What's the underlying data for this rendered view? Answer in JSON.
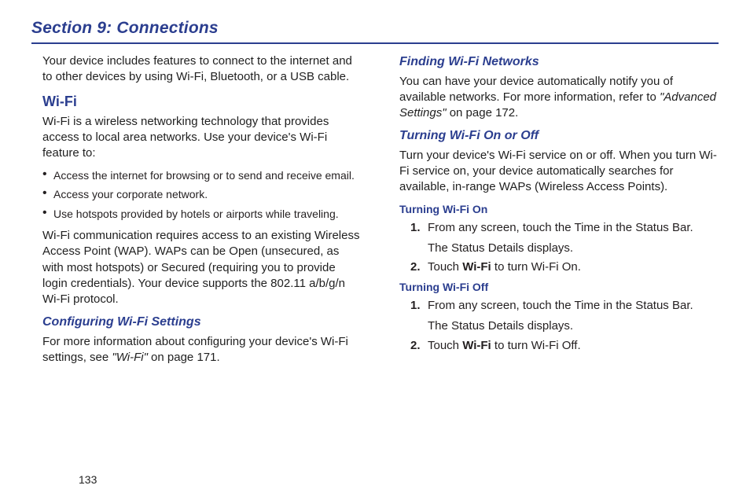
{
  "section": {
    "title": "Section 9: Connections"
  },
  "left": {
    "intro": "Your device includes features to connect to the internet and to other devices by using Wi-Fi, Bluetooth, or a USB cable.",
    "wifi_h2": "Wi-Fi",
    "wifi_intro": "Wi-Fi is a wireless networking technology that provides access to local area networks. Use your device's Wi-Fi feature to:",
    "bullets": [
      "Access the internet for browsing or to send and receive email.",
      "Access your corporate network.",
      "Use hotspots provided by hotels or airports while traveling."
    ],
    "wifi_wap": "Wi-Fi communication requires access to an existing Wireless Access Point (WAP). WAPs can be Open (unsecured, as with most hotspots) or Secured (requiring you to provide login credentials). Your device supports the 802.11 a/b/g/n Wi-Fi protocol.",
    "conf_h3": "Configuring Wi-Fi Settings",
    "conf_text_pre": "For more information about configuring your device's Wi-Fi settings, see ",
    "conf_ref": "\"Wi-Fi\"",
    "conf_text_post": " on page 171."
  },
  "right": {
    "find_h3": "Finding Wi-Fi Networks",
    "find_text_pre": "You can have your device automatically notify you of available networks. For more information, refer to ",
    "find_ref": "\"Advanced Settings\"",
    "find_text_post": "  on page 172.",
    "turn_h3": "Turning Wi-Fi On or Off",
    "turn_text": "Turn your device's Wi-Fi service on or off. When you turn Wi-Fi service on, your device automatically searches for available, in-range WAPs (Wireless Access Points).",
    "on_h4": "Turning Wi-Fi On",
    "on_steps": [
      {
        "num": "1.",
        "main": "From any screen, touch the Time in the Status Bar.",
        "sub": "The Status Details displays."
      },
      {
        "num": "2.",
        "main_pre": "Touch ",
        "main_bold": "Wi-Fi",
        "main_post": " to turn Wi-Fi On."
      }
    ],
    "off_h4": "Turning Wi-Fi Off",
    "off_steps": [
      {
        "num": "1.",
        "main": "From any screen, touch the Time in the Status Bar.",
        "sub": "The Status Details displays."
      },
      {
        "num": "2.",
        "main_pre": "Touch ",
        "main_bold": "Wi-Fi",
        "main_post": " to turn Wi-Fi Off."
      }
    ]
  },
  "page_number": "133"
}
